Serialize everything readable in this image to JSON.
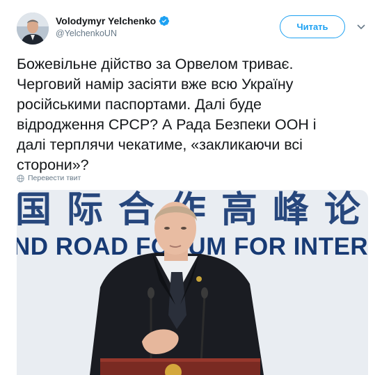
{
  "author": {
    "display_name": "Volodymyr Yelchenko",
    "handle": "@YelchenkoUN",
    "verified": true
  },
  "follow_button": {
    "label": "Читать"
  },
  "tweet": {
    "lines": [
      "Божевільне дійство за Орвелом триває.",
      "Черговий намір засіяти вже всю Україну",
      "російськими паспортами. Далі буде",
      "відродження СРСР? А Рада Безпеки ООН і",
      "далі терплячи чекатиме, «закликаючи всі",
      "сторони»?"
    ],
    "translate_label": "Перевести твит"
  },
  "media": {
    "banner_cjk": "国际合作高峰论",
    "banner_en": "ND ROAD FORUM FOR INTER"
  },
  "colors": {
    "accent": "#1da1f2",
    "text": "#14171a",
    "secondary": "#657786",
    "banner": "#173a74"
  },
  "icons": [
    "verified-badge-icon",
    "chevron-down-icon",
    "globe-icon"
  ]
}
